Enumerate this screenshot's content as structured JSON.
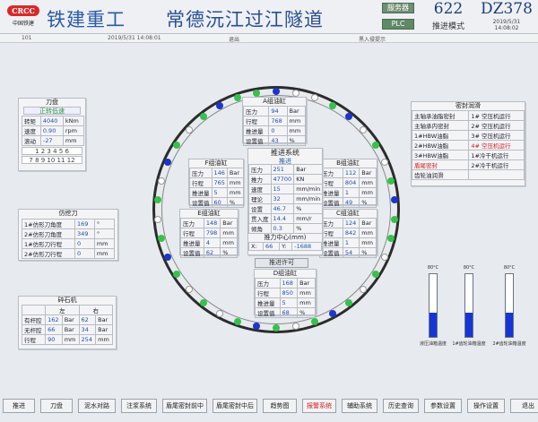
{
  "header": {
    "company": "铁建重工",
    "project": "常德沅江过江隧道",
    "logo_text": "中国铁建",
    "logo_mark": "CRCC",
    "server": "服务器",
    "plc": "PLC",
    "ring_no": "622",
    "mode": "推进模式",
    "machine": "DZ378",
    "date": "2019/5/31",
    "time": "14:08:02"
  },
  "info_bar": {
    "left": "101",
    "timestamp": "2019/5/31 14:08:01",
    "middle": "退出",
    "right": "黑入侵提示"
  },
  "cutter": {
    "title": "刀盘",
    "status": "正转低速",
    "rows": [
      {
        "label": "转矩",
        "value": "4040",
        "unit": "kNm"
      },
      {
        "label": "速度",
        "value": "0.90",
        "unit": "rpm"
      },
      {
        "label": "滚动",
        "value": "-27",
        "unit": "mm"
      }
    ],
    "mode_row1": "1 2 3 4 5 6",
    "mode_row2": "7 8 9 10 11 12"
  },
  "copy_cutter": {
    "title": "仿挖刀",
    "rows": [
      {
        "label": "1#仿形刀角度",
        "value": "169",
        "unit": "°"
      },
      {
        "label": "2#仿形刀角度",
        "value": "349",
        "unit": "°"
      },
      {
        "label": "1#仿形刀行程",
        "value": "0",
        "unit": "mm"
      },
      {
        "label": "2#仿形刀行程",
        "value": "0",
        "unit": "mm"
      }
    ]
  },
  "crusher": {
    "title": "碎石机",
    "col_left": "左",
    "col_right": "右",
    "rows": [
      {
        "label": "有杆腔",
        "left": "162",
        "left_unit": "Bar",
        "right": "62",
        "right_unit": "Bar"
      },
      {
        "label": "无杆腔",
        "left": "66",
        "left_unit": "Bar",
        "right": "34",
        "right_unit": "Bar"
      },
      {
        "label": "行程",
        "left": "90",
        "left_unit": "mm",
        "right": "254",
        "right_unit": "mm"
      }
    ]
  },
  "cyl_a": {
    "title": "A组油缸",
    "rows": [
      {
        "label": "压力",
        "value": "94",
        "unit": "Bar"
      },
      {
        "label": "行程",
        "value": "768",
        "unit": "mm"
      },
      {
        "label": "推进量",
        "value": "0",
        "unit": "mm"
      },
      {
        "label": "设置值",
        "value": "43",
        "unit": "%"
      }
    ]
  },
  "cyl_f": {
    "title": "F组油缸",
    "rows": [
      {
        "label": "压力",
        "value": "146",
        "unit": "Bar"
      },
      {
        "label": "行程",
        "value": "765",
        "unit": "mm"
      },
      {
        "label": "推进量",
        "value": "5",
        "unit": "mm"
      },
      {
        "label": "设置值",
        "value": "60",
        "unit": "%"
      }
    ]
  },
  "cyl_b": {
    "title": "B组油缸",
    "rows": [
      {
        "label": "压力",
        "value": "112",
        "unit": "Bar"
      },
      {
        "label": "行程",
        "value": "804",
        "unit": "mm"
      },
      {
        "label": "推进量",
        "value": "1",
        "unit": "mm"
      },
      {
        "label": "设置值",
        "value": "49",
        "unit": "%"
      }
    ]
  },
  "cyl_e": {
    "title": "E组油缸",
    "rows": [
      {
        "label": "压力",
        "value": "148",
        "unit": "Bar"
      },
      {
        "label": "行程",
        "value": "798",
        "unit": "mm"
      },
      {
        "label": "推进量",
        "value": "4",
        "unit": "mm"
      },
      {
        "label": "设置值",
        "value": "62",
        "unit": "%"
      }
    ]
  },
  "cyl_c": {
    "title": "C组油缸",
    "rows": [
      {
        "label": "压力",
        "value": "124",
        "unit": "Bar"
      },
      {
        "label": "行程",
        "value": "842",
        "unit": "mm"
      },
      {
        "label": "推进量",
        "value": "1",
        "unit": "mm"
      },
      {
        "label": "设置值",
        "value": "54",
        "unit": "%"
      }
    ]
  },
  "cyl_d": {
    "title": "D组油缸",
    "rows": [
      {
        "label": "压力",
        "value": "168",
        "unit": "Bar"
      },
      {
        "label": "行程",
        "value": "850",
        "unit": "mm"
      },
      {
        "label": "推进量",
        "value": "5",
        "unit": "mm"
      },
      {
        "label": "设置值",
        "value": "68",
        "unit": "%"
      }
    ]
  },
  "thrust": {
    "title": "推进系统",
    "sub": "推进",
    "rows": [
      {
        "label": "压力",
        "value": "251",
        "unit": "Bar"
      },
      {
        "label": "推力",
        "value": "47700",
        "unit": "KN"
      },
      {
        "label": "速度",
        "value": "15",
        "unit": "mm/min"
      },
      {
        "label": "理论",
        "value": "32",
        "unit": "mm/min"
      },
      {
        "label": "设置",
        "value": "46.7",
        "unit": "%"
      },
      {
        "label": "贯入度",
        "value": "14.4",
        "unit": "mm/r"
      },
      {
        "label": "倾角",
        "value": "0.3",
        "unit": "%"
      }
    ],
    "center_label": "推力中心(mm)",
    "x_label": "X:",
    "x_value": "66",
    "y_label": "Y:",
    "y_value": "-1688",
    "permit": "推进许可"
  },
  "seal": {
    "title": "密封润滑",
    "rows": [
      {
        "left": "主轴承油脂密封",
        "right": "1# 空压机运行",
        "lred": false,
        "rred": false
      },
      {
        "left": "主轴承内密封",
        "right": "2# 空压机运行",
        "lred": false,
        "rred": false
      },
      {
        "left": "1#HBW油脂",
        "right": "3# 空压机运行",
        "lred": false,
        "rred": false
      },
      {
        "left": "2#HBW油脂",
        "right": "4# 空压机运行",
        "lred": false,
        "rred": true
      },
      {
        "left": "3#HBW油脂",
        "right": "1#冷干机运行",
        "lred": false,
        "rred": false
      },
      {
        "left": "盾尾密封",
        "right": "2#冷干机运行",
        "lred": true,
        "rred": false
      },
      {
        "left": "齿轮油润滑",
        "right": "",
        "lred": false,
        "rred": false
      }
    ]
  },
  "gauges": [
    {
      "max": "80°C",
      "label": "液压油箱温度",
      "level": 0.38
    },
    {
      "max": "80°C",
      "label": "1#齿轮油箱温度",
      "level": 0.39
    },
    {
      "max": "80°C",
      "label": "2#齿轮油箱温度",
      "level": 0.39
    }
  ],
  "nav": [
    "推进",
    "刀盘",
    "泥水对路",
    "注浆系统",
    "盾尾密封前中",
    "盾尾密封中后",
    "趋势图",
    "报警系统",
    "辅助系统",
    "历史查询",
    "参数设置",
    "操作设置",
    "退出"
  ],
  "colors": {
    "green": "#35c24a",
    "blue": "#1d35c9",
    "red": "#d21d1d",
    "title_blue": "#2a5aa8"
  }
}
